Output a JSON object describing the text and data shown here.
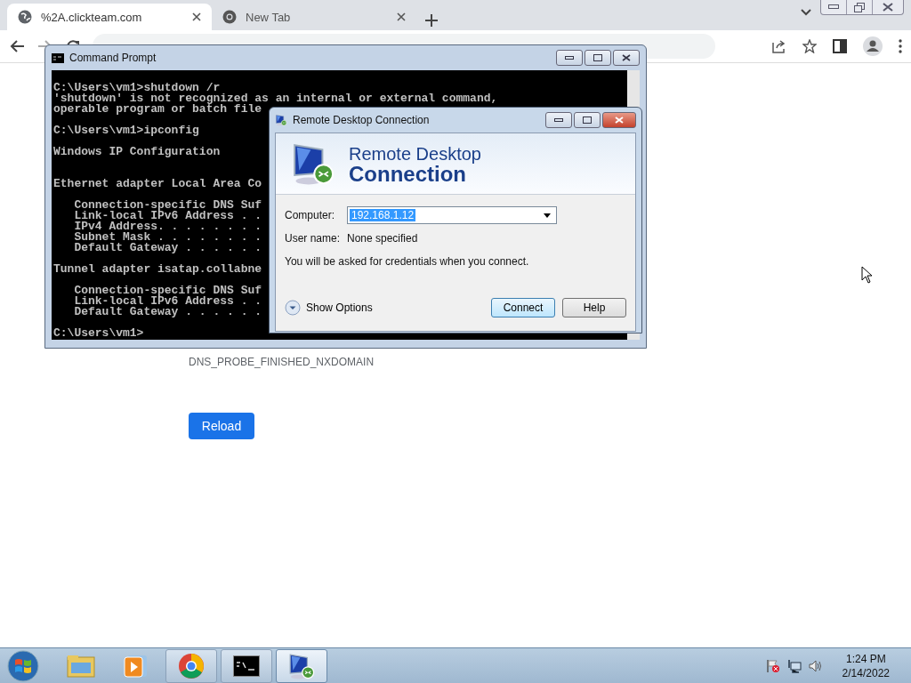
{
  "browser": {
    "tabs": [
      {
        "title": "%2A.clickteam.com",
        "selected": true
      },
      {
        "title": "New Tab",
        "selected": false
      }
    ],
    "page": {
      "error_code": "DNS_PROBE_FINISHED_NXDOMAIN",
      "reload_button": "Reload"
    }
  },
  "cmd_window": {
    "title": "Command Prompt",
    "blocks": [
      {
        "lines": [
          "C:\\Users\\vm1>shutdown /r",
          "'shutdown' is not recognized as an internal or external command,",
          "operable program or batch file"
        ],
        "extra_blank_after": false
      },
      {
        "lines": [
          "C:\\Users\\vm1>ipconfig"
        ],
        "extra_blank_after": false
      },
      {
        "lines": [
          "Windows IP Configuration"
        ],
        "extra_blank_after": true
      },
      {
        "lines": [
          "Ethernet adapter Local Area Co"
        ],
        "extra_blank_after": false
      },
      {
        "lines": [
          "   Connection-specific DNS Suf",
          "   Link-local IPv6 Address . .",
          "   IPv4 Address. . . . . . . .",
          "   Subnet Mask . . . . . . . .",
          "   Default Gateway . . . . . ."
        ],
        "extra_blank_after": false
      },
      {
        "lines": [
          "Tunnel adapter isatap.collabne"
        ],
        "extra_blank_after": false
      },
      {
        "lines": [
          "   Connection-specific DNS Suf",
          "   Link-local IPv6 Address . .",
          "   Default Gateway . . . . . ."
        ],
        "extra_blank_after": false
      },
      {
        "lines": [
          "C:\\Users\\vm1>"
        ],
        "extra_blank_after": false
      }
    ]
  },
  "rdp_window": {
    "title": "Remote Desktop Connection",
    "banner_line1": "Remote Desktop",
    "banner_line2": "Connection",
    "computer_label": "Computer:",
    "computer_value": "192.168.1.12",
    "username_label": "User name:",
    "username_value": "None specified",
    "note": "You will be asked for credentials when you connect.",
    "show_options": "Show Options",
    "buttons": [
      {
        "label": "Connect",
        "default": true
      },
      {
        "label": "Help",
        "default": false
      }
    ]
  },
  "taskbar": {
    "items": [
      {
        "kind": "explorer",
        "running": false,
        "selected": false
      },
      {
        "kind": "media",
        "running": false,
        "selected": false
      },
      {
        "kind": "chrome",
        "running": true,
        "selected": false
      },
      {
        "kind": "cmd",
        "running": true,
        "selected": false
      },
      {
        "kind": "rdp",
        "running": true,
        "selected": true
      }
    ],
    "time": "1:24 PM",
    "date": "2/14/2022"
  }
}
